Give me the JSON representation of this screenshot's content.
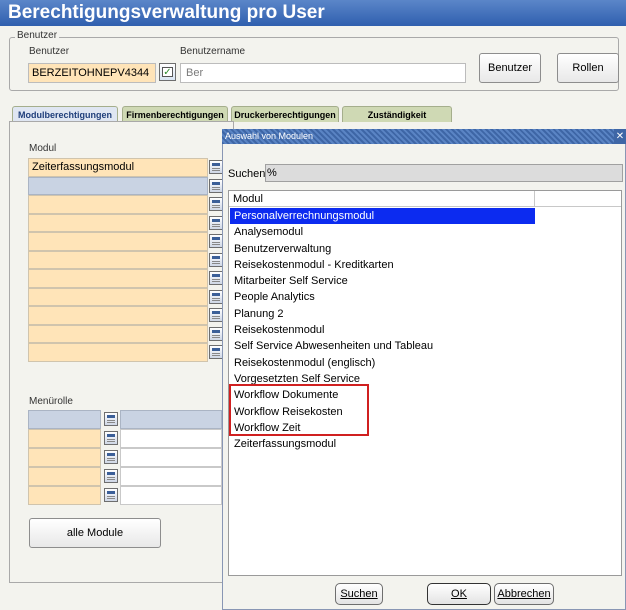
{
  "window": {
    "title": "Berechtigungsverwaltung pro User"
  },
  "benutzer_group": {
    "label": "Benutzer",
    "benutzer_label": "Benutzer",
    "benutzername_label": "Benutzername",
    "benutzer_value": "BERZEITOHNEPV4344",
    "benutzername_value": "Ber",
    "benutzer_button": "Benutzer",
    "rollen_button": "Rollen"
  },
  "tabs": [
    {
      "label": "Modulberechtigungen",
      "active": true
    },
    {
      "label": "Firmenberechtigungen",
      "active": false
    },
    {
      "label": "Druckerberechtigungen",
      "active": false
    },
    {
      "label": "Zuständigkeit",
      "active": false
    }
  ],
  "main_panel": {
    "modul_label": "Modul",
    "modul_rows": [
      "Zeiterfassungsmodul",
      "",
      "",
      "",
      "",
      "",
      "",
      "",
      "",
      "",
      ""
    ],
    "menuerolle_label": "Menürolle",
    "alle_module_button": "alle Module"
  },
  "dialog": {
    "title": "Auswahl von Modulen",
    "close_glyph": "✕",
    "search_label": "Suchen",
    "search_value": "%",
    "list_header": "Modul",
    "items": [
      "Personalverrechnungsmodul",
      "Analysemodul",
      "Benutzerverwaltung",
      "Reisekostenmodul - Kreditkarten",
      "Mitarbeiter Self Service",
      "People Analytics",
      "Planung 2",
      "Reisekostenmodul",
      "Self Service Abwesenheiten und Tableau",
      "Reisekostenmodul (englisch)",
      "Vorgesetzten Self Service",
      "Workflow Dokumente",
      "Workflow Reisekosten",
      "Workflow Zeit",
      "Zeiterfassungsmodul"
    ],
    "selected_index": 0,
    "buttons": {
      "suchen": "Suchen",
      "ok": "OK",
      "abbrechen": "Abbrechen"
    }
  },
  "colors": {
    "title_bar": "#2f5fae",
    "required_field": "#ffe4b8",
    "selection": "#0c2bf0",
    "highlight_box": "#d02020"
  }
}
